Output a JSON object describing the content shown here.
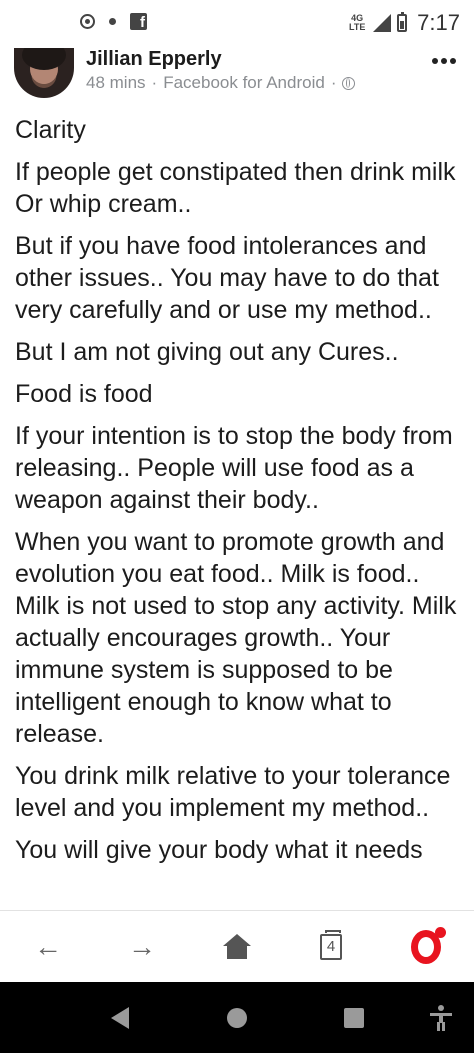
{
  "status_bar": {
    "left_icons": [
      "screen-record-icon",
      "notification-dot-icon",
      "facebook-icon"
    ],
    "network": "4G LTE",
    "time": "7:17"
  },
  "post": {
    "author": "Jillian Epperly",
    "time_ago": "48 mins",
    "separator": "·",
    "source": "Facebook for Android",
    "privacy_icon": "globe-icon",
    "paragraphs": [
      "Clarity",
      "If people get constipated then drink milk Or whip cream..",
      "But if you have food intolerances and other issues.. You may have to do that very carefully and or use my method..",
      "But I am not giving out any Cures..",
      "Food is food",
      "If your intention is to stop the body from releasing.. People will use food as a weapon against their body..",
      "When you want to promote growth and evolution you eat food.. Milk is food.. Milk is not used to stop any activity. Milk actually encourages growth.. Your immune system is supposed to be intelligent enough to know what to release.",
      "You drink milk relative to your tolerance level and you implement my method..",
      "You will give your body what it needs"
    ]
  },
  "browser_toolbar": {
    "back_glyph": "←",
    "forward_glyph": "→",
    "tab_count": "4",
    "brand_color": "#e8141f"
  },
  "system_nav": {
    "buttons": [
      "back",
      "home",
      "recents",
      "accessibility"
    ]
  }
}
